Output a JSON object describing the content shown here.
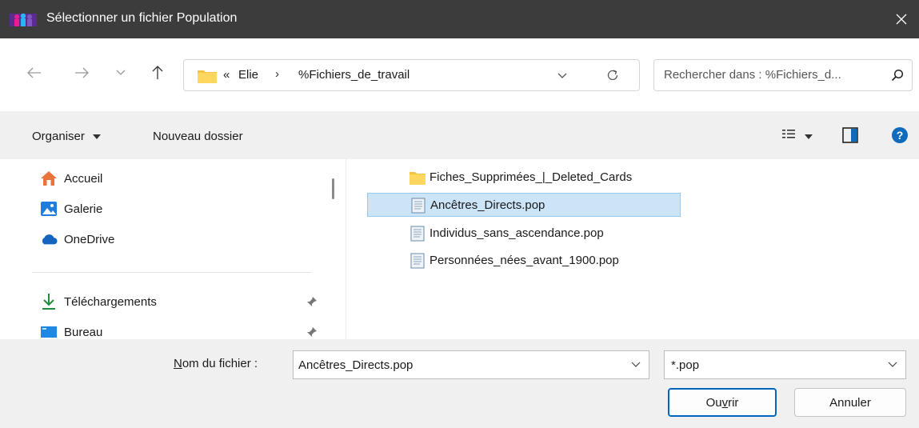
{
  "window": {
    "title": "Sélectionner un fichier Population"
  },
  "address": {
    "overflow": "«",
    "crumbs": [
      "Elie",
      "%Fichiers_de_travail"
    ],
    "separator": "›"
  },
  "search": {
    "placeholder": "Rechercher dans : %Fichiers_d..."
  },
  "toolbar": {
    "organize": "Organiser",
    "new_folder": "Nouveau dossier"
  },
  "nav": {
    "items": [
      {
        "label": "Accueil",
        "icon": "home-icon"
      },
      {
        "label": "Galerie",
        "icon": "gallery-icon"
      },
      {
        "label": "OneDrive",
        "icon": "cloud-icon"
      },
      {
        "label": "Téléchargements",
        "icon": "download-icon",
        "pinned": true
      },
      {
        "label": "Bureau",
        "icon": "desktop-icon",
        "pinned": true
      }
    ]
  },
  "files": [
    {
      "name": "Fiches_Supprimées_|_Deleted_Cards",
      "type": "folder",
      "selected": false
    },
    {
      "name": "Ancêtres_Directs.pop",
      "type": "file",
      "selected": true
    },
    {
      "name": "Individus_sans_ascendance.pop",
      "type": "file",
      "selected": false
    },
    {
      "name": "Personnées_nées_avant_1900.pop",
      "type": "file",
      "selected": false
    }
  ],
  "bottom": {
    "filename_label": "Nom du fichier :",
    "filename_value": "Ancêtres_Directs.pop",
    "filetype_value": "*.pop",
    "open_label": "Ouvrir",
    "cancel_label": "Annuler"
  },
  "colors": {
    "accent": "#0067c0",
    "selection": "#cce4f7",
    "titlebar": "#3c3c3c",
    "help": "#0f6cbd"
  }
}
